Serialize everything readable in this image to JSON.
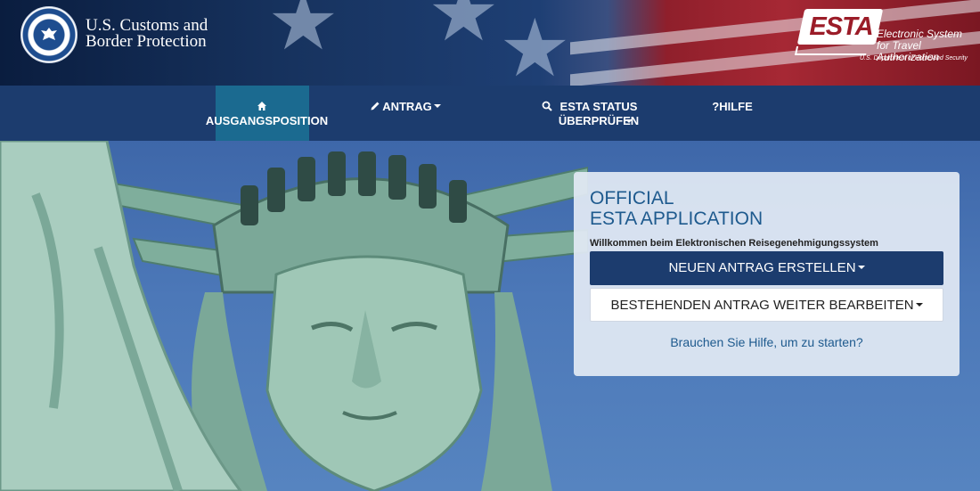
{
  "header": {
    "agency_name": "U.S. Customs and Border Protection",
    "esta_logo_text": "ESTA",
    "esta_subtitle": "Electronic System for Travel Authorization",
    "esta_dhs": "U.S. Department of Homeland Security"
  },
  "nav": {
    "items": [
      {
        "label": "AUSGANGSPOSITION",
        "icon": "home-icon",
        "active": true,
        "dropdown": false
      },
      {
        "label": "ANTRAG",
        "icon": "pencil-icon",
        "active": false,
        "dropdown": true
      },
      {
        "label": "ESTA STATUS ÜBERPRÜFEN",
        "icon": "search-icon",
        "active": false,
        "dropdown": true
      },
      {
        "label": "HILFE",
        "icon": "question-icon",
        "active": false,
        "dropdown": false
      }
    ]
  },
  "panel": {
    "title_line1": "OFFICIAL",
    "title_line2": "ESTA APPLICATION",
    "welcome": "Willkommen beim Elektronischen Reisegenehmigungssystem",
    "new_application": "NEUEN ANTRAG ERSTELLEN",
    "continue_application": "BESTEHENDEN ANTRAG WEITER BEARBEITEN",
    "help_link": "Brauchen Sie Hilfe, um zu starten?"
  },
  "colors": {
    "nav_bg": "#1c3c6e",
    "nav_active": "#1b6a90",
    "primary_button": "#1c3c6e",
    "title_blue": "#1e5a8e",
    "esta_red": "#9b1c28"
  }
}
